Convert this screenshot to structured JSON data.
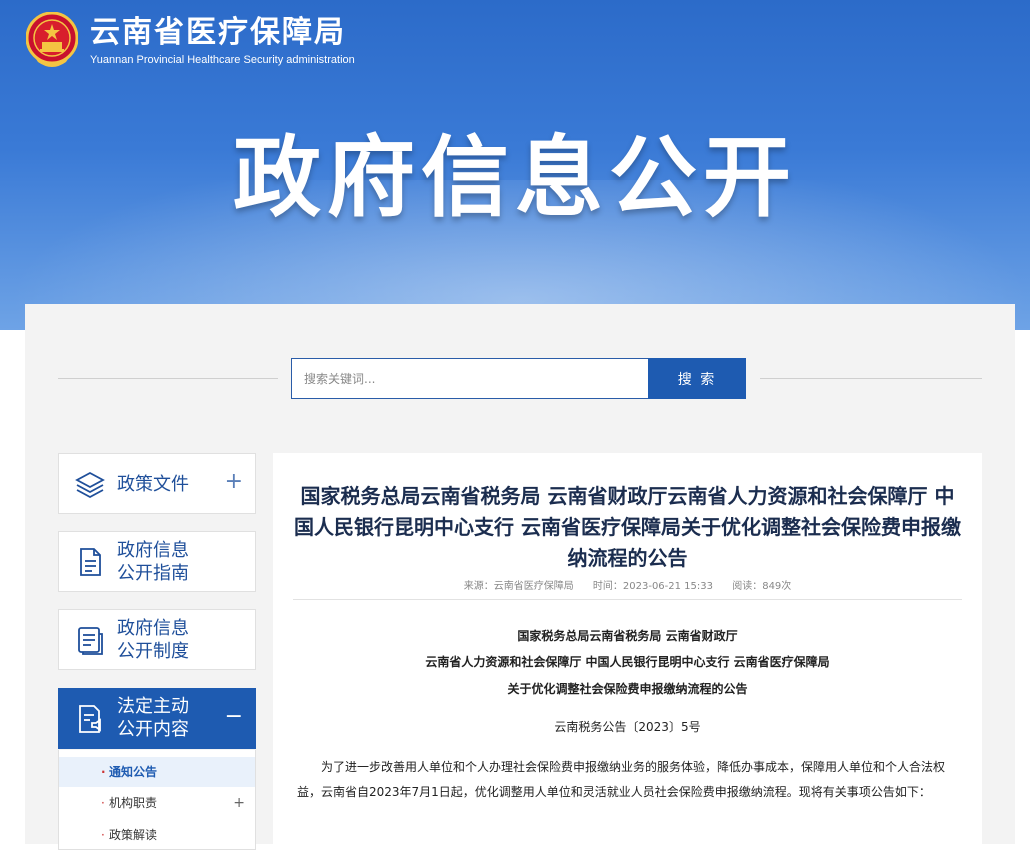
{
  "header": {
    "site_title_zh": "云南省医疗保障局",
    "site_title_en": "Yuannan Provincial Healthcare Security administration",
    "banner_title": "政府信息公开",
    "emblem_icon": "national-emblem-icon"
  },
  "search": {
    "placeholder": "搜索关键词...",
    "button_label": "搜 索"
  },
  "sidebar": {
    "items": [
      {
        "label": "政策文件",
        "icon": "layers-icon",
        "toggle": "+"
      },
      {
        "label": "政府信息\n公开指南",
        "icon": "document-icon"
      },
      {
        "label": "政府信息\n公开制度",
        "icon": "document-list-icon"
      },
      {
        "label": "法定主动\n公开内容",
        "icon": "document-speaker-icon",
        "toggle": "−"
      }
    ],
    "subitems": [
      {
        "label": "通知公告"
      },
      {
        "label": "机构职责",
        "toggle": "+"
      },
      {
        "label": "政策解读"
      }
    ]
  },
  "article": {
    "title": "国家税务总局云南省税务局 云南省财政厅云南省人力资源和社会保障厅 中国人民银行昆明中心支行 云南省医疗保障局关于优化调整社会保险费申报缴纳流程的公告",
    "source": "来源：云南省医疗保障局",
    "time": "时间：2023-06-21 15:33",
    "views": "阅读：849次",
    "heading_lines": [
      "国家税务总局云南省税务局 云南省财政厅",
      "云南省人力资源和社会保障厅 中国人民银行昆明中心支行 云南省医疗保障局",
      "关于优化调整社会保险费申报缴纳流程的公告"
    ],
    "doc_number": "云南税务公告〔2023〕5号",
    "paragraph": "为了进一步改善用人单位和个人办理社会保险费申报缴纳业务的服务体验，降低办事成本，保障用人单位和个人合法权益，云南省自2023年7月1日起，优化调整用人单位和灵活就业人员社会保险费申报缴纳流程。现将有关事项公告如下："
  },
  "colors": {
    "primary_blue": "#1e5bb1",
    "hero_top": "#2c6bc9",
    "panel_bg": "#f3f3f3",
    "title_text": "#1b2d4f"
  }
}
